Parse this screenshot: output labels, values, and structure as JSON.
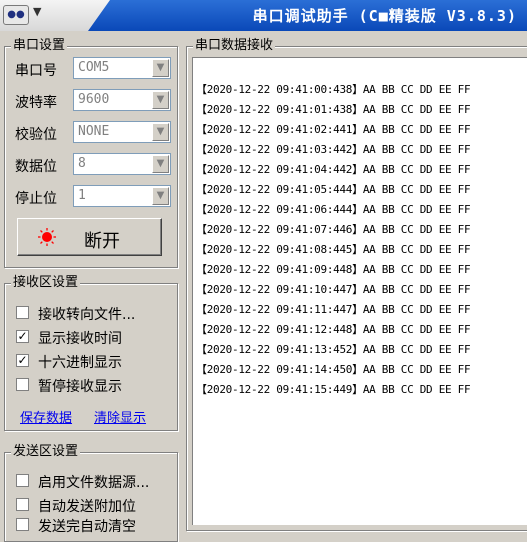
{
  "titlebar": {
    "skin_icon": "skin-icon",
    "title": "串口调试助手 (C■精装版 V3.8.3)"
  },
  "serial_settings": {
    "group_title": "串口设置",
    "fields": [
      {
        "label": "串口号",
        "value": "COM5"
      },
      {
        "label": "波特率",
        "value": "9600"
      },
      {
        "label": "校验位",
        "value": "NONE"
      },
      {
        "label": "数据位",
        "value": "8"
      },
      {
        "label": "停止位",
        "value": "1"
      }
    ],
    "open_button_label": "断开",
    "lamp_color": "#ff0000"
  },
  "receive_settings": {
    "group_title": "接收区设置",
    "options": [
      {
        "label": "接收转向文件...",
        "checked": false
      },
      {
        "label": "显示接收时间",
        "checked": true
      },
      {
        "label": "十六进制显示",
        "checked": true
      },
      {
        "label": "暂停接收显示",
        "checked": false
      }
    ],
    "save_link": "保存数据",
    "clear_link": "清除显示"
  },
  "send_settings": {
    "group_title": "发送区设置",
    "options": [
      {
        "label": "启用文件数据源...",
        "checked": false
      },
      {
        "label": "自动发送附加位",
        "checked": false
      },
      {
        "label": "发送完自动清空",
        "checked": false
      }
    ]
  },
  "receive_panel": {
    "group_title": "串口数据接收",
    "lines": [
      "【2020-12-22 09:41:00:438】AA BB CC DD EE FF",
      "【2020-12-22 09:41:01:438】AA BB CC DD EE FF",
      "【2020-12-22 09:41:02:441】AA BB CC DD EE FF",
      "【2020-12-22 09:41:03:442】AA BB CC DD EE FF",
      "【2020-12-22 09:41:04:442】AA BB CC DD EE FF",
      "【2020-12-22 09:41:05:444】AA BB CC DD EE FF",
      "【2020-12-22 09:41:06:444】AA BB CC DD EE FF",
      "【2020-12-22 09:41:07:446】AA BB CC DD EE FF",
      "【2020-12-22 09:41:08:445】AA BB CC DD EE FF",
      "【2020-12-22 09:41:09:448】AA BB CC DD EE FF",
      "【2020-12-22 09:41:10:447】AA BB CC DD EE FF",
      "【2020-12-22 09:41:11:447】AA BB CC DD EE FF",
      "【2020-12-22 09:41:12:448】AA BB CC DD EE FF",
      "【2020-12-22 09:41:13:452】AA BB CC DD EE FF",
      "【2020-12-22 09:41:14:450】AA BB CC DD EE FF",
      "【2020-12-22 09:41:15:449】AA BB CC DD EE FF"
    ]
  }
}
